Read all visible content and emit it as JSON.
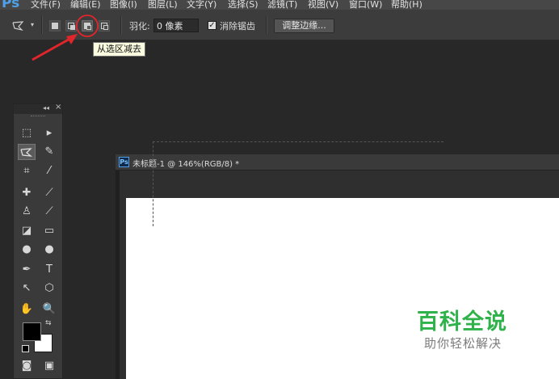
{
  "app": {
    "logo": "Ps"
  },
  "menu": [
    "文件(F)",
    "编辑(E)",
    "图像(I)",
    "图层(L)",
    "文字(Y)",
    "选择(S)",
    "滤镜(T)",
    "视图(V)",
    "窗口(W)",
    "帮助(H)"
  ],
  "options": {
    "feather_label": "羽化:",
    "feather_value": "0 像素",
    "antialias_checked": true,
    "antialias_label": "消除锯齿",
    "refine_edge_label": "调整边缘..."
  },
  "tooltip": "从选区减去",
  "annotation_color": "#e0262a",
  "tools_panel": {
    "collapse": "◂◂",
    "close": "×",
    "foreground_color": "#000000",
    "background_color": "#ffffff"
  },
  "document": {
    "icon": "Ps",
    "title": "未标题-1 @ 146%(RGB/8) *"
  },
  "watermark": {
    "title": "百科全说",
    "subtitle": "助你轻松解决",
    "color": "#2fb24a"
  }
}
